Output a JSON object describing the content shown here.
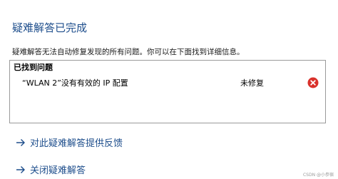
{
  "title": "疑难解答已完成",
  "description": "疑难解答无法自动修复发现的所有问题。你可以在下面找到详细信息。",
  "problems": {
    "header": "已找到问题",
    "items": [
      {
        "name": "“WLAN 2”没有有效的 IP 配置",
        "status": "未修复",
        "icon": "error-icon"
      }
    ]
  },
  "links": [
    {
      "label": "对此疑难解答提供反馈",
      "icon": "arrow-right-icon"
    },
    {
      "label": "关闭疑难解答",
      "icon": "arrow-right-icon"
    }
  ],
  "watermark": "CSDN @小参宿",
  "colors": {
    "accent": "#1e4e8c",
    "error": "#d9312b"
  }
}
